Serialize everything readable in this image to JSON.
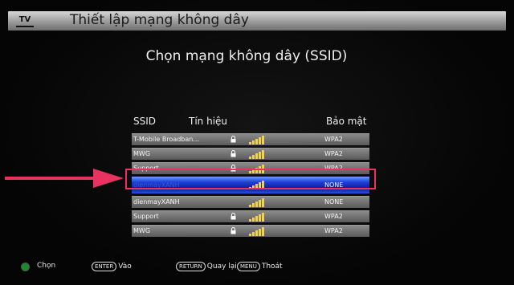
{
  "header": {
    "tv_badge": "TV",
    "title": "Thiết lập mạng không dây"
  },
  "subtitle": "Chọn mạng không dây (SSID)",
  "columns": {
    "ssid": "SSID",
    "signal": "Tín hiệu",
    "security": "Bảo mật"
  },
  "networks": [
    {
      "ssid": "T-Mobile Broadban...",
      "locked": true,
      "signal_bars": 4,
      "security": "WPA2"
    },
    {
      "ssid": "MWG",
      "locked": true,
      "signal_bars": 4,
      "security": "WPA2"
    },
    {
      "ssid": "Support",
      "locked": true,
      "signal_bars": 4,
      "security": "WPA2"
    },
    {
      "ssid": "dienmayXANH",
      "locked": false,
      "signal_bars": 4,
      "security": "NONE",
      "selected": true
    },
    {
      "ssid": "dienmayXANH",
      "locked": false,
      "signal_bars": 4,
      "security": "NONE"
    },
    {
      "ssid": "Support",
      "locked": true,
      "signal_bars": 4,
      "security": "WPA2"
    },
    {
      "ssid": "MWG",
      "locked": true,
      "signal_bars": 4,
      "security": "WPA2"
    }
  ],
  "footer": {
    "select_label": "Chọn",
    "enter_key": "ENTER",
    "enter_label": "Vào",
    "return_key": "RETURN",
    "return_label": "Quay lại",
    "menu_key": "MENU",
    "menu_label": "Thoát"
  },
  "colors": {
    "highlight": "#e8325f",
    "selected_row": "#1d3fd6",
    "signal": "#f1d24a"
  }
}
